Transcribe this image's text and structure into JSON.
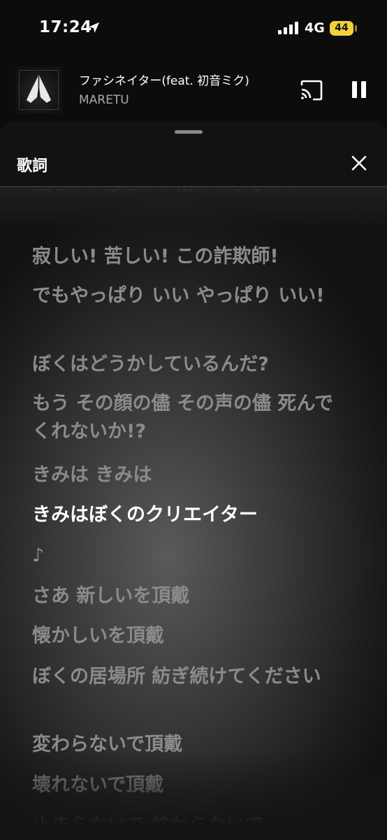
{
  "status_bar": {
    "time": "17:24",
    "network": "4G",
    "battery": "44",
    "battery_color": "#f0d23a"
  },
  "now_playing": {
    "title": "ファシネイター(feat. 初音ミク)",
    "artist": "MARETU"
  },
  "sheet": {
    "title": "歌詞"
  },
  "lyrics": [
    {
      "text": "愛しい! 恋しい! 憎い! 悲しい!"
    },
    {
      "text": "寂しい! 苦しい! この詐欺師!"
    },
    {
      "text": "でもやっぱり いい やっぱり いい!"
    },
    {
      "text": "ぼくはどうかしているんだ?"
    },
    {
      "text": "もう その顔の儘 その声の儘 死んでくれないか!?"
    },
    {
      "text": "きみは きみは"
    },
    {
      "text": "きみはぼくのクリエイター",
      "active": true
    },
    {
      "text": "♪"
    },
    {
      "text": "さあ 新しいを頂戴"
    },
    {
      "text": "懐かしいを頂戴"
    },
    {
      "text": "ぼくの居場所 紡ぎ続けてください"
    },
    {
      "text": "変わらないで頂戴"
    },
    {
      "text": "壊れないで頂戴"
    },
    {
      "text": "止まらないで 終わらないで"
    }
  ],
  "colors": {
    "active_lyric": "#ffffff",
    "inactive_lyric": "#8b8b8b"
  }
}
